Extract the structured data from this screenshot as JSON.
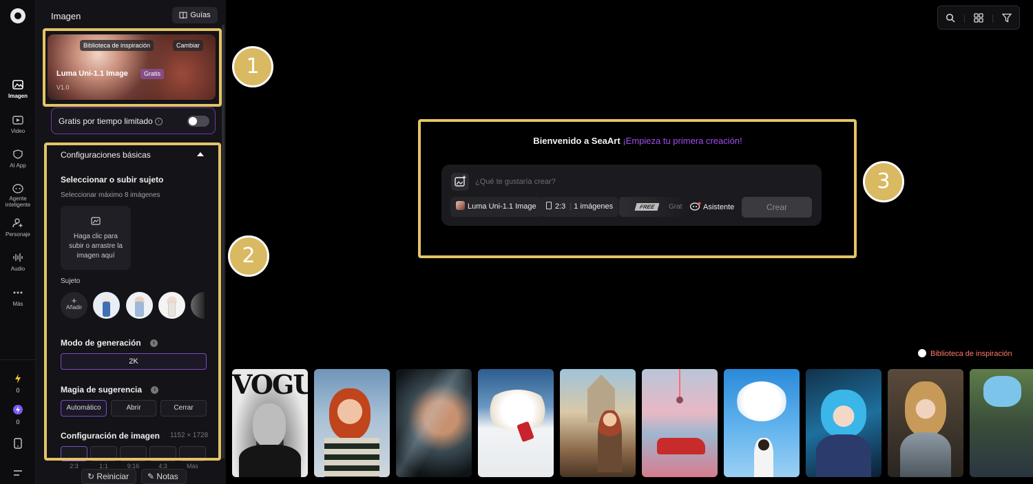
{
  "rail": {
    "items": [
      {
        "label": "Imagen"
      },
      {
        "label": "Video"
      },
      {
        "label": "AI App"
      },
      {
        "label": "Agente inteligente"
      },
      {
        "label": "Personaje"
      },
      {
        "label": "Audio"
      },
      {
        "label": "Más"
      }
    ],
    "credits_1": "0",
    "credits_2": "0"
  },
  "panel": {
    "title": "Imagen",
    "guides_label": "Guías",
    "model": {
      "library_chip": "Biblioteca de inspiración",
      "change_chip": "Cambiar",
      "name": "Luma Uni-1.1 Image",
      "badge": "Gratis",
      "version": "V1.0"
    },
    "free_toggle_label": "Gratis por tiempo limitado",
    "basic_settings_title": "Configuraciones básicas",
    "subject_title": "Seleccionar o subir sujeto",
    "subject_sub": "Seleccionar máximo 8 imágenes",
    "upload_text": "Haga clic para subir o arrastre la imagen aquí",
    "subject_label": "Sujeto",
    "add_label": "Añadir",
    "generation_mode_title": "Modo de generación",
    "generation_mode_value": "2K",
    "prompt_magic_title": "Magia de sugerencia",
    "prompt_magic_options": [
      "Automático",
      "Abrir",
      "Cerrar"
    ],
    "image_config_title": "Configuración de imagen",
    "image_config_size": "1152 × 1728",
    "ratios": [
      "2:3",
      "1:1",
      "9:16",
      "4:3",
      "Más"
    ],
    "reset_label": "Reiniciar",
    "notes_label": "Notas"
  },
  "main": {
    "welcome": "Bienvenido a SeaArt",
    "welcome_accent": "¡Empieza tu primera creación!",
    "prompt_placeholder": "¿Qué te gustaría crear?",
    "model_chip": "Luma Uni-1.1 Image",
    "ratio_chip": "2:3",
    "count_chip": "1 imágenes",
    "free_tag": "FREE",
    "free_text": "Grat",
    "assistant": "Asistente",
    "create_label": "Crear",
    "library_link": "Biblioteca de inspiración",
    "vogue_text": "VOGUE"
  },
  "annotations": [
    "1",
    "2",
    "3"
  ],
  "colors": {
    "accent": "#a44cf0",
    "highlight": "#e4c466",
    "library_link": "#ff7a6a"
  }
}
